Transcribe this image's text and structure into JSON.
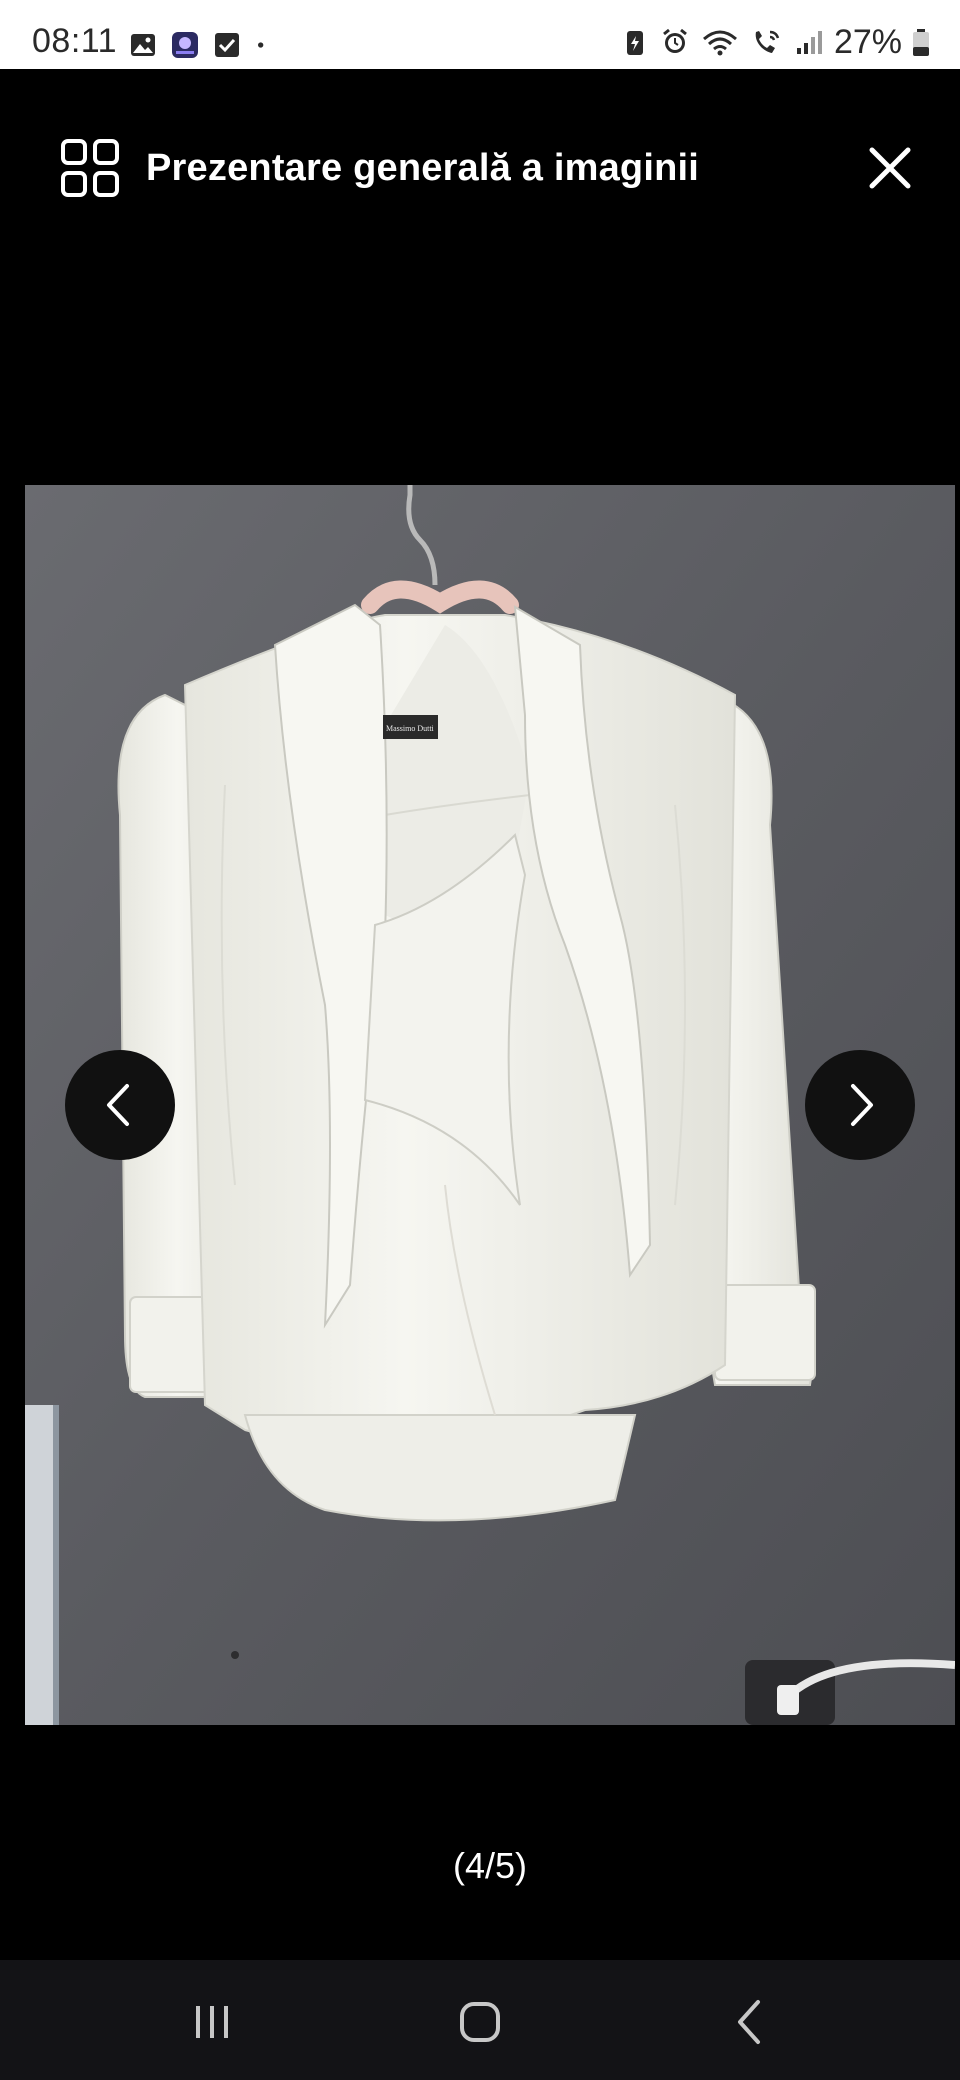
{
  "status_bar": {
    "time": "08:11",
    "battery": "27%",
    "left_icons": [
      "gallery-icon",
      "app-icon",
      "checkbox-icon",
      "dot-icon"
    ],
    "right_icons": [
      "battery-saver-icon",
      "alarm-icon",
      "wifi-icon",
      "wifi-call-icon",
      "signal-icon",
      "battery-icon"
    ]
  },
  "header": {
    "title": "Prezentare generală a imaginii",
    "grid_icon": "grid-icon",
    "close_icon": "close-icon"
  },
  "viewer": {
    "image_description_icon": "photo",
    "prev_icon": "chevron-left-icon",
    "next_icon": "chevron-right-icon",
    "counter": "(4/5)"
  },
  "label": {
    "brand_text": "Massimo Dutti"
  },
  "nav_bar": {
    "icons": [
      "recent-apps-icon",
      "home-icon",
      "back-icon"
    ]
  },
  "colors": {
    "background": "#000000",
    "status_bar": "#ffffff",
    "wall": "#5b5c60",
    "blouse": "#f2f2ec",
    "hanger": "#e7c4bb",
    "nav_bar": "#131316"
  }
}
